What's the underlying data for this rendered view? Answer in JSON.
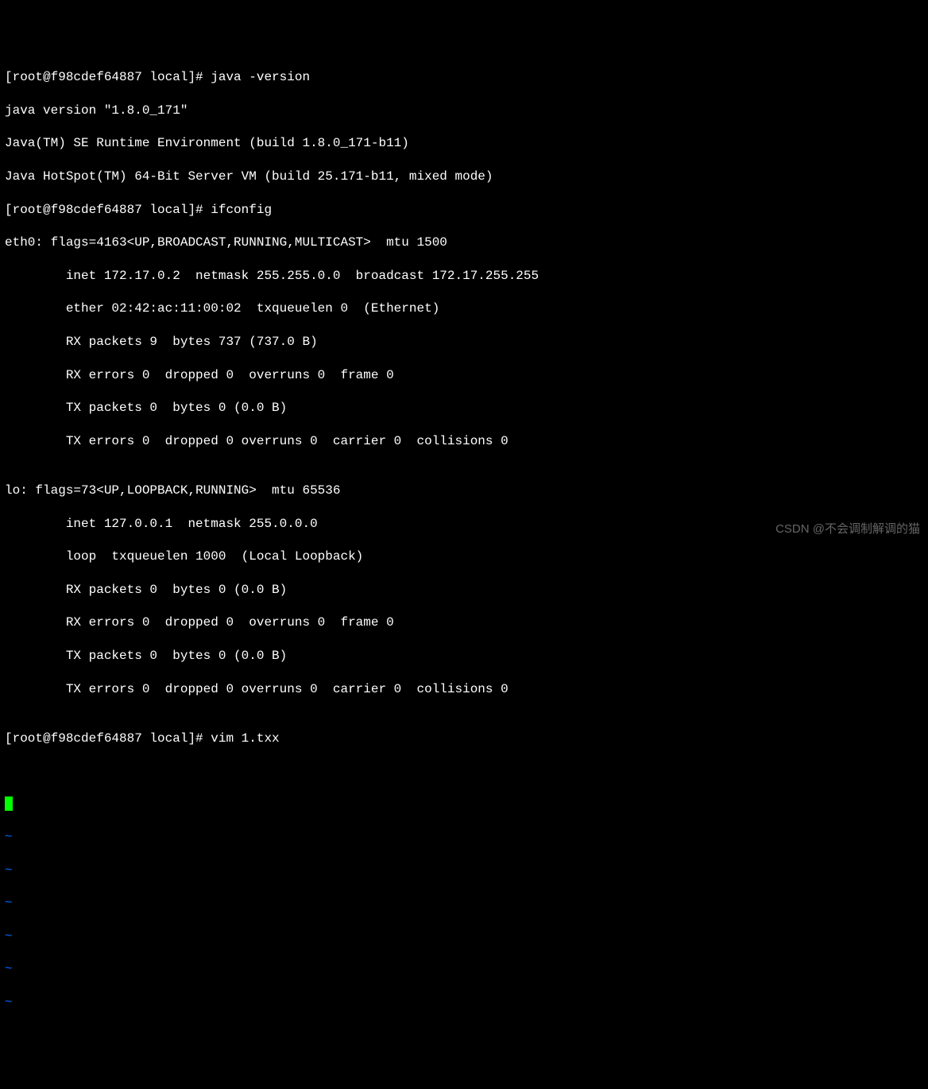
{
  "lines": {
    "l1": "[root@f98cdef64887 local]# java -version",
    "l2": "java version \"1.8.0_171\"",
    "l3": "Java(TM) SE Runtime Environment (build 1.8.0_171-b11)",
    "l4": "Java HotSpot(TM) 64-Bit Server VM (build 25.171-b11, mixed mode)",
    "l5": "[root@f98cdef64887 local]# ifconfig",
    "l6": "eth0: flags=4163<UP,BROADCAST,RUNNING,MULTICAST>  mtu 1500",
    "l7": "        inet 172.17.0.2  netmask 255.255.0.0  broadcast 172.17.255.255",
    "l8": "        ether 02:42:ac:11:00:02  txqueuelen 0  (Ethernet)",
    "l9": "        RX packets 9  bytes 737 (737.0 B)",
    "l10": "        RX errors 0  dropped 0  overruns 0  frame 0",
    "l11": "        TX packets 0  bytes 0 (0.0 B)",
    "l12": "        TX errors 0  dropped 0 overruns 0  carrier 0  collisions 0",
    "l13": "",
    "l14": "lo: flags=73<UP,LOOPBACK,RUNNING>  mtu 65536",
    "l15": "        inet 127.0.0.1  netmask 255.0.0.0",
    "l16": "        loop  txqueuelen 1000  (Local Loopback)",
    "l17": "        RX packets 0  bytes 0 (0.0 B)",
    "l18": "        RX errors 0  dropped 0  overruns 0  frame 0",
    "l19": "        TX packets 0  bytes 0 (0.0 B)",
    "l20": "        TX errors 0  dropped 0 overruns 0  carrier 0  collisions 0",
    "l21": "",
    "l22": "[root@f98cdef64887 local]# vim 1.txx"
  },
  "tilde": "~",
  "watermark": "CSDN @不会调制解调的猫"
}
